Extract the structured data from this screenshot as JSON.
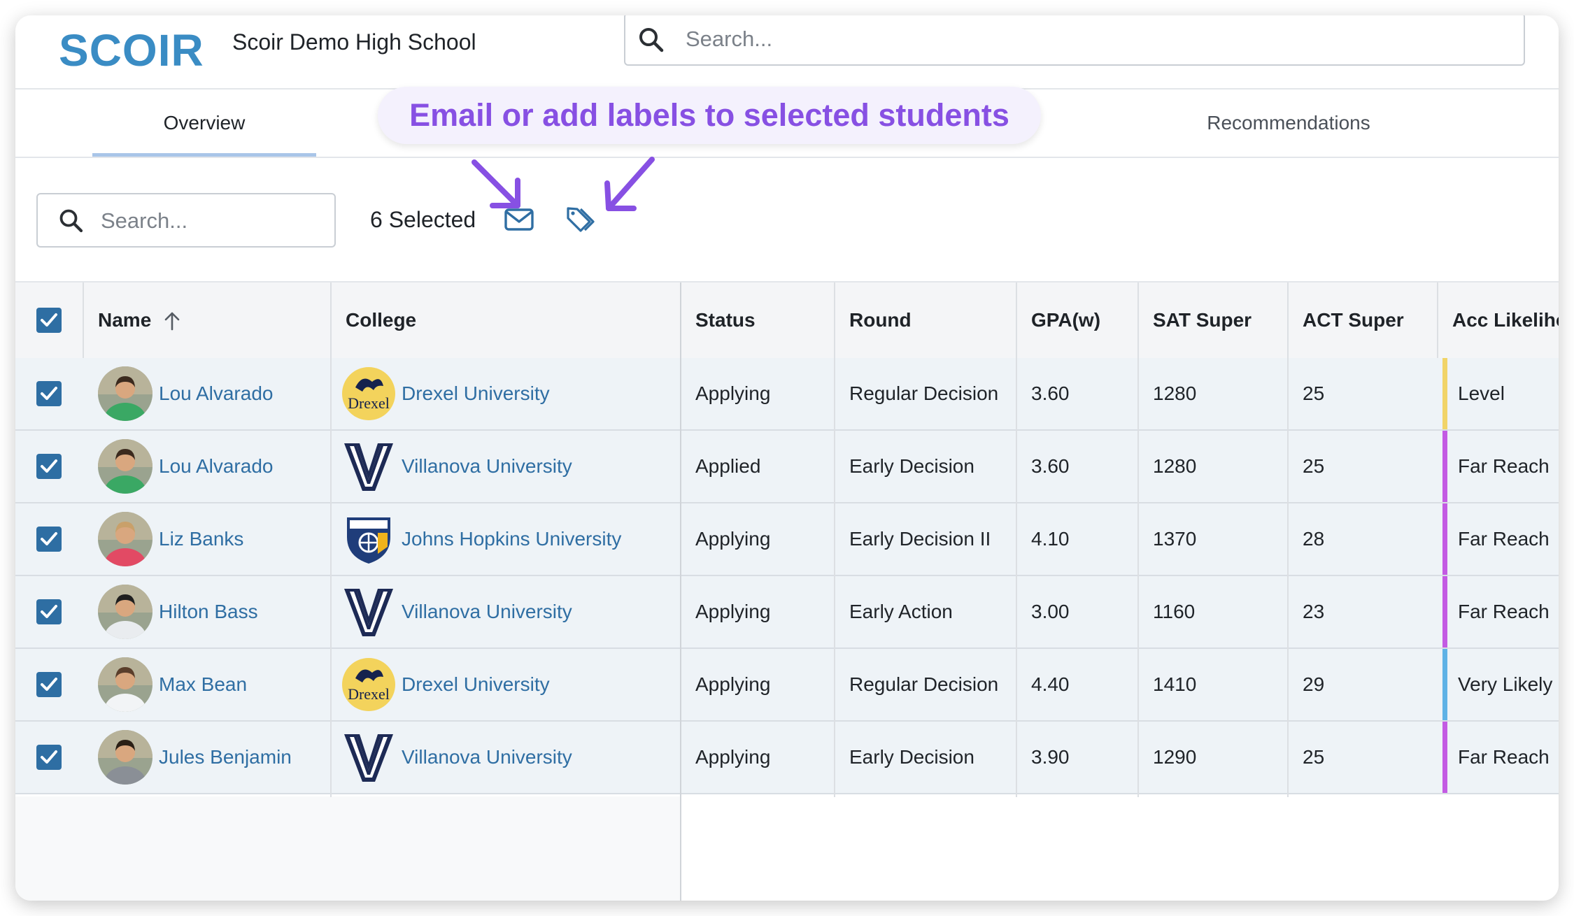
{
  "header": {
    "logo_text": "SCOIR",
    "school_name": "Scoir Demo High School",
    "search_placeholder": "Search..."
  },
  "tabs": [
    {
      "label": "Overview",
      "active": true
    },
    {
      "label": "Recommendations",
      "active": false
    }
  ],
  "callout": {
    "text": "Email or add labels to selected students",
    "color": "#8750e3"
  },
  "toolbar": {
    "search_placeholder": "Search...",
    "selected_text": "6 Selected",
    "email_icon": "envelope-icon",
    "label_icon": "tags-icon"
  },
  "table": {
    "columns": [
      "Name",
      "College",
      "Status",
      "Round",
      "GPA(w)",
      "SAT Super",
      "ACT Super",
      "Acc Likeliho"
    ],
    "rows": [
      {
        "name": "Lou Alvarado",
        "avatar": "student-photo",
        "college": "Drexel University",
        "college_logo": "drexel",
        "status": "Applying",
        "round": "Regular Decision",
        "gpa": "3.60",
        "sat": "1280",
        "act": "25",
        "likelihood": "Level",
        "likelihood_color": "#f1d468"
      },
      {
        "name": "Lou Alvarado",
        "avatar": "student-photo",
        "college": "Villanova University",
        "college_logo": "villanova",
        "status": "Applied",
        "round": "Early Decision",
        "gpa": "3.60",
        "sat": "1280",
        "act": "25",
        "likelihood": "Far Reach",
        "likelihood_color": "#c35be3"
      },
      {
        "name": "Liz Banks",
        "avatar": "student-photo",
        "college": "Johns Hopkins University",
        "college_logo": "jhu",
        "status": "Applying",
        "round": "Early Decision II",
        "gpa": "4.10",
        "sat": "1370",
        "act": "28",
        "likelihood": "Far Reach",
        "likelihood_color": "#c35be3"
      },
      {
        "name": "Hilton Bass",
        "avatar": "student-photo",
        "college": "Villanova University",
        "college_logo": "villanova",
        "status": "Applying",
        "round": "Early Action",
        "gpa": "3.00",
        "sat": "1160",
        "act": "23",
        "likelihood": "Far Reach",
        "likelihood_color": "#c35be3"
      },
      {
        "name": "Max Bean",
        "avatar": "student-photo",
        "college": "Drexel University",
        "college_logo": "drexel",
        "status": "Applying",
        "round": "Regular Decision",
        "gpa": "4.40",
        "sat": "1410",
        "act": "29",
        "likelihood": "Very Likely",
        "likelihood_color": "#5fb2e6"
      },
      {
        "name": "Jules Benjamin",
        "avatar": "student-photo",
        "college": "Villanova University",
        "college_logo": "villanova",
        "status": "Applying",
        "round": "Early Decision",
        "gpa": "3.90",
        "sat": "1290",
        "act": "25",
        "likelihood": "Far Reach",
        "likelihood_color": "#c35be3"
      }
    ]
  },
  "colors": {
    "brand": "#3a8cc4",
    "link": "#2f6ea3",
    "checkbox": "#2e6ea3",
    "row_bg": "#eef3f7"
  }
}
